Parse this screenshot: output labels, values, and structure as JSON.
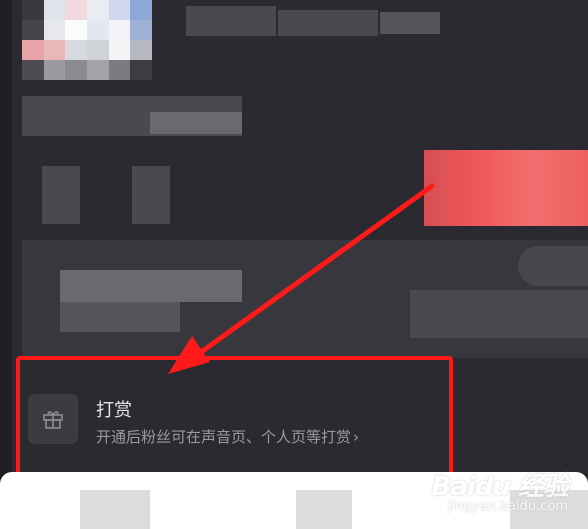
{
  "tip": {
    "title": "打赏",
    "description": "开通后粉丝可在声音页、个人页等打赏",
    "chevron": "›",
    "icon": "gift-icon"
  },
  "watermark": {
    "brand": "Baidu 经验",
    "url": "jingyan.baidu.com"
  },
  "colors": {
    "background": "#2b2a31",
    "highlight": "#ff1a1a",
    "accent_red": "#f0585b",
    "text_primary": "#e6e5ea",
    "text_secondary": "#9a99a0"
  }
}
